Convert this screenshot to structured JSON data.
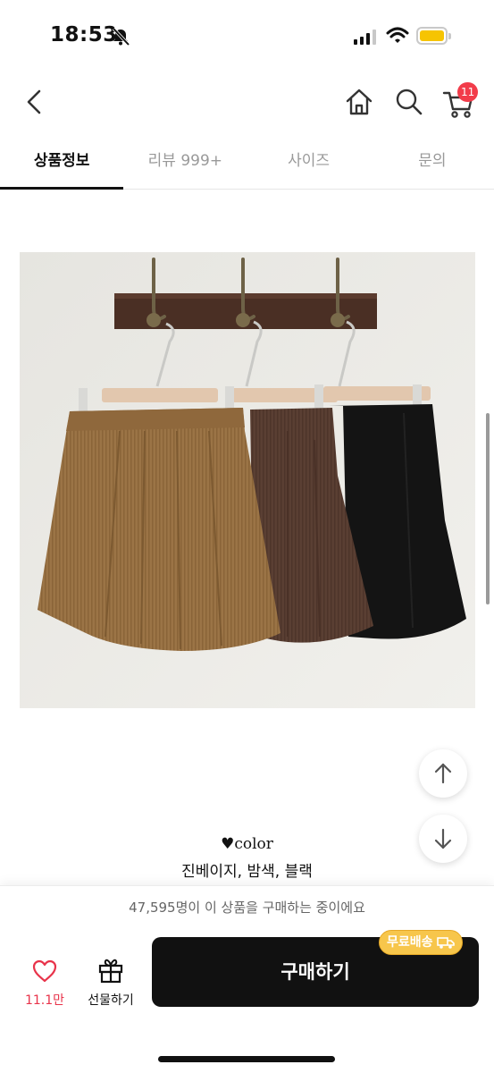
{
  "status_bar": {
    "time": "18:53",
    "battery_color": "#f6c402"
  },
  "nav": {
    "icons": [
      "chevron-left-icon",
      "home-icon",
      "search-icon",
      "cart-icon"
    ],
    "cart_count": "11"
  },
  "tabs": [
    {
      "label": "상품정보",
      "active": true
    },
    {
      "label": "리뷰 999+",
      "active": false
    },
    {
      "label": "사이즈",
      "active": false
    },
    {
      "label": "문의",
      "active": false
    }
  ],
  "product": {
    "color_heading": "♥color",
    "colors": "진베이지, 밤색, 블랙"
  },
  "notice": {
    "text": "47,595명이 이 상품을 구매하는 중이에요"
  },
  "bottom_bar": {
    "like_count": "11.1만",
    "gift_label": "선물하기",
    "free_shipping_label": "무료배송",
    "buy_label": "구매하기",
    "accent_color": "#e8334a",
    "badge_color": "#f7c64b"
  }
}
